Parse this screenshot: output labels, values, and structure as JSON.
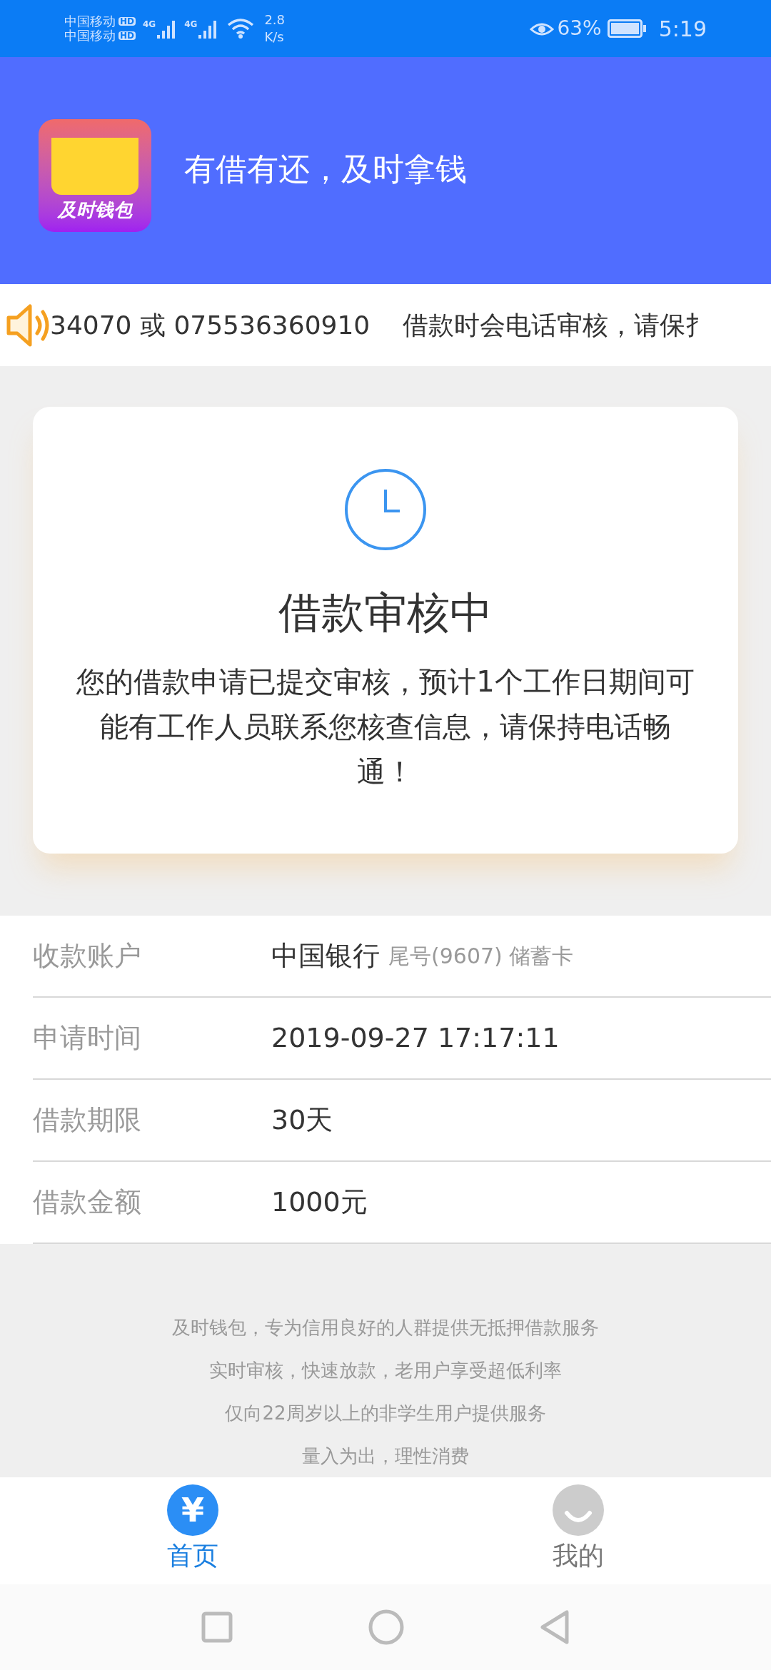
{
  "status_bar": {
    "carriers": [
      {
        "name": "中国移动",
        "badge": "HD"
      },
      {
        "name": "中国移动",
        "badge": "HD"
      }
    ],
    "networks": [
      "4G",
      "4G"
    ],
    "speed": [
      "2.8",
      "K/s"
    ],
    "battery": "63%",
    "time": "5:19"
  },
  "header": {
    "logo_text": "及时钱包",
    "slogan": "有借有还，及时拿钱"
  },
  "notice": {
    "text": "34070 或 075536360910    借款时会电话审核，请保扌"
  },
  "status_card": {
    "title": "借款审核中",
    "message": "您的借款申请已提交审核，预计1个工作日期间可能有工作人员联系您核查信息，请保持电话畅通！"
  },
  "details": [
    {
      "label": "收款账户",
      "value": "中国银行",
      "note": "尾号(9607) 储蓄卡"
    },
    {
      "label": "申请时间",
      "value": "2019-09-27 17:17:11"
    },
    {
      "label": "借款期限",
      "value": "30天"
    },
    {
      "label": "借款金额",
      "value": "1000元"
    }
  ],
  "footer": [
    "及时钱包，专为信用良好的人群提供无抵押借款服务",
    "实时审核，快速放款，老用户享受超低利率",
    "仅向22周岁以上的非学生用户提供服务",
    "量入为出，理性消费"
  ],
  "tabs": [
    {
      "label": "首页",
      "kind": "yuan",
      "glyph": "¥",
      "selected": true
    },
    {
      "label": "我的",
      "kind": "smile",
      "selected": false
    }
  ]
}
